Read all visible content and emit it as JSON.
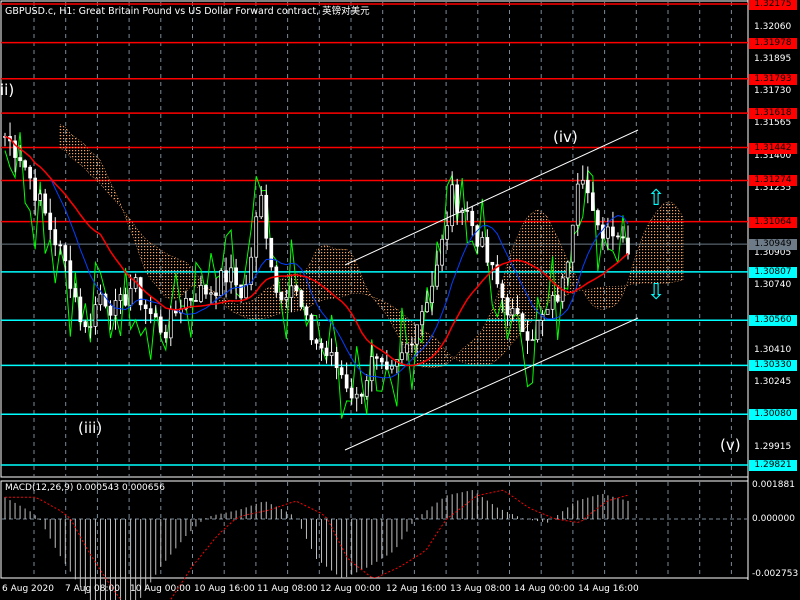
{
  "header": {
    "title": "GBPUSD.c, H1:  Great Britain Pound vs US Dollar Forward contract, 英镑对美元"
  },
  "price_axis": {
    "ticks": [
      "1.32060",
      "1.31895",
      "1.31730",
      "1.31565",
      "1.31400",
      "1.31235",
      "1.30905",
      "1.30740",
      "1.30410",
      "1.30245",
      "1.29915"
    ],
    "red_levels": [
      "1.32175",
      "1.31978",
      "1.31793",
      "1.31618",
      "1.31442",
      "1.31274",
      "1.31064"
    ],
    "cyan_levels": [
      "1.30807",
      "1.30560",
      "1.30330",
      "1.30080",
      "1.29821"
    ],
    "bid": "1.30949",
    "colors": {
      "red": "#ff0000",
      "cyan": "#00ffff",
      "bid": "#6d7a87"
    }
  },
  "waves": {
    "w2": "ii)",
    "w3": "(iii)",
    "w4": "(iv)",
    "w5": "(v)"
  },
  "arrows": {
    "up": "up-arrow",
    "down": "down-arrow"
  },
  "time_axis": [
    "6 Aug 2020",
    "7 Aug 08:00",
    "10 Aug 00:00",
    "10 Aug 16:00",
    "11 Aug 08:00",
    "12 Aug 00:00",
    "12 Aug 16:00",
    "13 Aug 08:00",
    "14 Aug 00:00",
    "14 Aug 16:00"
  ],
  "macd": {
    "label": "MACD(12,26,9) 0.000543 0.000656",
    "ticks": [
      "0.001881",
      "0.000000",
      "-0.002753"
    ]
  },
  "chart_data": {
    "type": "candlestick",
    "symbol": "GBPUSD.c",
    "timeframe": "H1",
    "ylim": [
      1.29821,
      1.32175
    ],
    "price_keypoints": [
      1.315,
      1.314,
      1.312,
      1.31,
      1.308,
      1.305,
      1.307,
      1.306,
      1.3075,
      1.306,
      1.305,
      1.3065,
      1.307,
      1.3072,
      1.308,
      1.3068,
      1.312,
      1.307,
      1.3075,
      1.305,
      1.304,
      1.303,
      1.3015,
      1.3035,
      1.3025,
      1.304,
      1.306,
      1.308,
      1.312,
      1.311,
      1.309,
      1.307,
      1.3055,
      1.305,
      1.306,
      1.3075,
      1.314,
      1.31,
      1.3105,
      1.3095
    ],
    "macd_keypoints": [
      0.0012,
      0.0004,
      -0.0008,
      -0.0018,
      -0.0026,
      -0.0022,
      -0.0012,
      -0.0004,
      0.0002,
      0.0005,
      0.001,
      0.0003,
      -0.001,
      -0.0015,
      -0.0012,
      -0.0008,
      0.0002,
      0.0013,
      0.0016,
      0.0006,
      0.0,
      -0.0001,
      0.001,
      0.0014,
      0.001
    ]
  }
}
